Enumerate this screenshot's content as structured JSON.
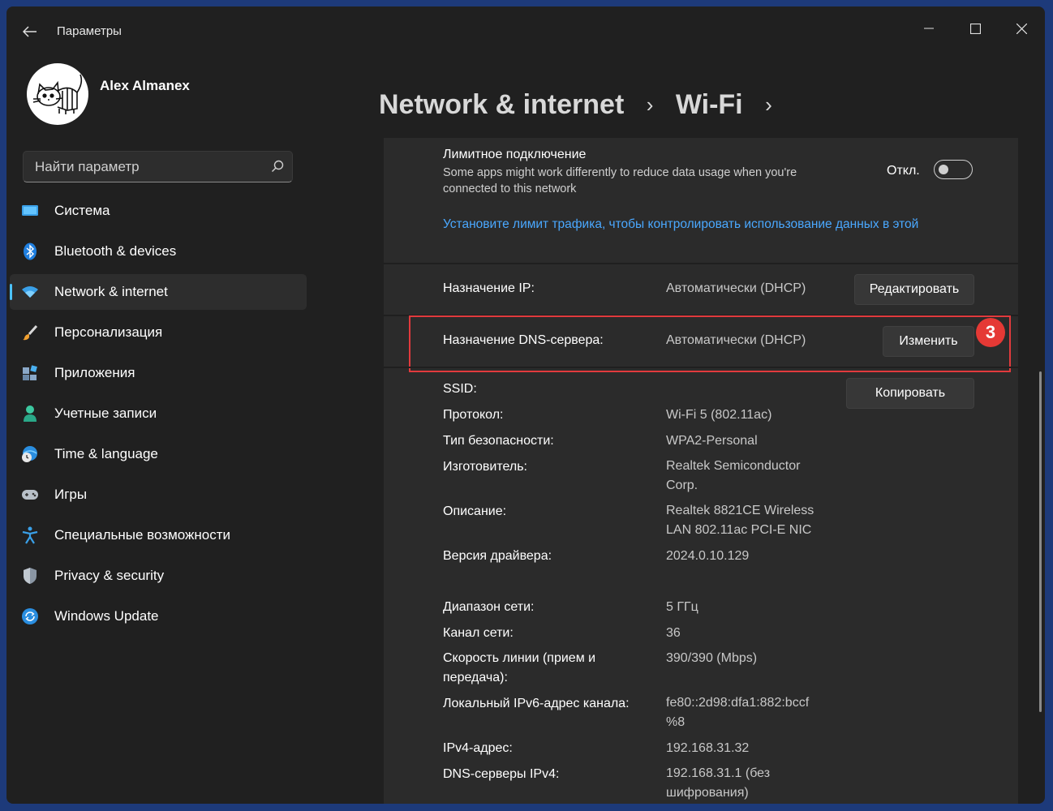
{
  "window": {
    "title": "Параметры"
  },
  "profile": {
    "name": "Alex Almanex"
  },
  "search": {
    "placeholder": "Найти параметр"
  },
  "sidebar": {
    "items": [
      {
        "label": "Система",
        "icon": "system-icon"
      },
      {
        "label": "Bluetooth & devices",
        "icon": "bluetooth-icon"
      },
      {
        "label": "Network & internet",
        "icon": "wifi-icon",
        "active": true
      },
      {
        "label": "Персонализация",
        "icon": "brush-icon"
      },
      {
        "label": "Приложения",
        "icon": "apps-icon"
      },
      {
        "label": "Учетные записи",
        "icon": "person-icon"
      },
      {
        "label": "Time & language",
        "icon": "globe-clock-icon"
      },
      {
        "label": "Игры",
        "icon": "gamepad-icon"
      },
      {
        "label": "Специальные возможности",
        "icon": "accessibility-icon"
      },
      {
        "label": "Privacy & security",
        "icon": "shield-icon"
      },
      {
        "label": "Windows Update",
        "icon": "update-icon"
      }
    ]
  },
  "breadcrumb": {
    "items": [
      "Network & internet",
      "Wi-Fi"
    ],
    "separator": "›"
  },
  "metered": {
    "title": "Лимитное подключение",
    "description": "Some apps might work differently to reduce data usage when you're connected to this network",
    "toggle_label": "Откл.",
    "toggle_on": false,
    "link": "Установите лимит трафика, чтобы контролировать использование данных в этой"
  },
  "ip": {
    "label": "Назначение IP:",
    "value": "Автоматически (DHCP)",
    "button": "Редактировать"
  },
  "dns": {
    "label": "Назначение DNS-сервера:",
    "value": "Автоматически (DHCP)",
    "button": "Изменить"
  },
  "annotation": {
    "step": "3",
    "color": "#e13a3d"
  },
  "properties": {
    "copy_button": "Копировать",
    "ssid": {
      "label": "SSID:"
    },
    "protocol": {
      "label": "Протокол:",
      "value": "Wi-Fi 5 (802.11ac)"
    },
    "security": {
      "label": "Тип безопасности:",
      "value": "WPA2-Personal"
    },
    "manufacturer": {
      "label": "Изготовитель:",
      "value": "Realtek Semiconductor Corp."
    },
    "description": {
      "label": "Описание:",
      "value": "Realtek 8821CE Wireless LAN 802.11ac PCI-E NIC"
    },
    "driver": {
      "label": "Версия драйвера:",
      "value": "2024.0.10.129"
    },
    "band": {
      "label": "Диапазон сети:",
      "value": "5 ГГц"
    },
    "channel": {
      "label": "Канал сети:",
      "value": "36"
    },
    "link_speed": {
      "label": "Скорость линии (прием и передача):",
      "value": "390/390 (Mbps)"
    },
    "ipv6": {
      "label": "Локальный IPv6-адрес канала:",
      "value": "fe80::2d98:dfa1:882:bccf %8"
    },
    "ipv4": {
      "label": "IPv4-адрес:",
      "value": "192.168.31.32"
    },
    "dns_servers": {
      "label": "DNS-серверы IPv4:",
      "value": "192.168.31.1 (без шифрования)"
    }
  },
  "colors": {
    "accent": "#4cc2ff",
    "link": "#4aa8ff",
    "window_bg": "#202020",
    "content_bg": "#2b2b2b"
  }
}
